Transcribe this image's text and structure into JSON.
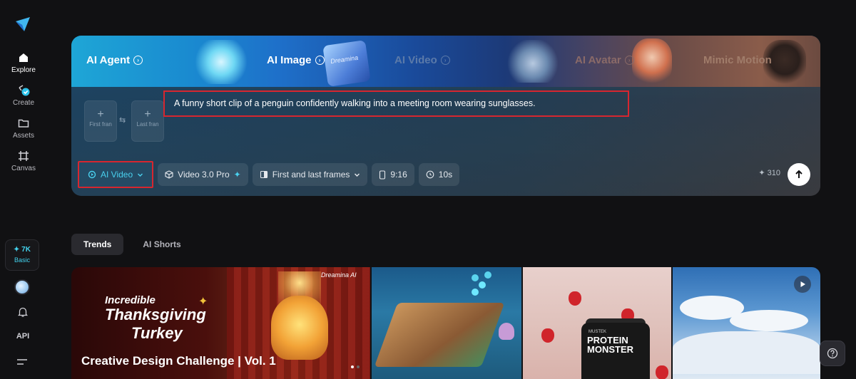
{
  "sidebar": {
    "logo_icon": "dreamina-logo",
    "items": [
      {
        "label": "Explore",
        "icon": "home-icon"
      },
      {
        "label": "Create",
        "icon": "create-icon"
      },
      {
        "label": "Assets",
        "icon": "folder-icon"
      },
      {
        "label": "Canvas",
        "icon": "canvas-icon"
      }
    ],
    "credits": {
      "amount": "✦ 7K",
      "plan": "Basic"
    },
    "api_label": "API"
  },
  "hero": {
    "tabs": [
      {
        "label": "AI Agent"
      },
      {
        "label": "AI Image"
      },
      {
        "label": "AI Video"
      },
      {
        "label": "AI Avatar"
      },
      {
        "label": "Mimic Motion"
      }
    ],
    "art_labels": {
      "image_art": "Dreamina"
    },
    "first_frame_label": "First fran",
    "last_frame_label": "Last fran",
    "swap_glyph": "⇆",
    "prompt": "A funny short clip of a penguin confidently walking into a meeting room wearing sunglasses.",
    "toolbar": {
      "mode": "AI Video",
      "model": "Video 3.0 Pro",
      "frames": "First and last frames",
      "ratio": "9:16",
      "duration": "10s"
    },
    "cost": "✦ 310"
  },
  "feed": {
    "tabs": [
      {
        "label": "Trends",
        "active": true
      },
      {
        "label": "AI Shorts",
        "active": false
      }
    ],
    "cards": {
      "c1": {
        "line1": "Incredible",
        "line2": "Thanksgiving",
        "line3": "Turkey",
        "brand": "Dreamina AI",
        "title": "Creative Design Challenge | Vol. 1"
      },
      "c3": {
        "jar_brand": "MUSTEK",
        "jar_text": "PROTEIN MONSTER"
      }
    }
  },
  "colors": {
    "accent": "#43d3ee",
    "highlight_border": "#d7262f",
    "background": "#111113"
  }
}
